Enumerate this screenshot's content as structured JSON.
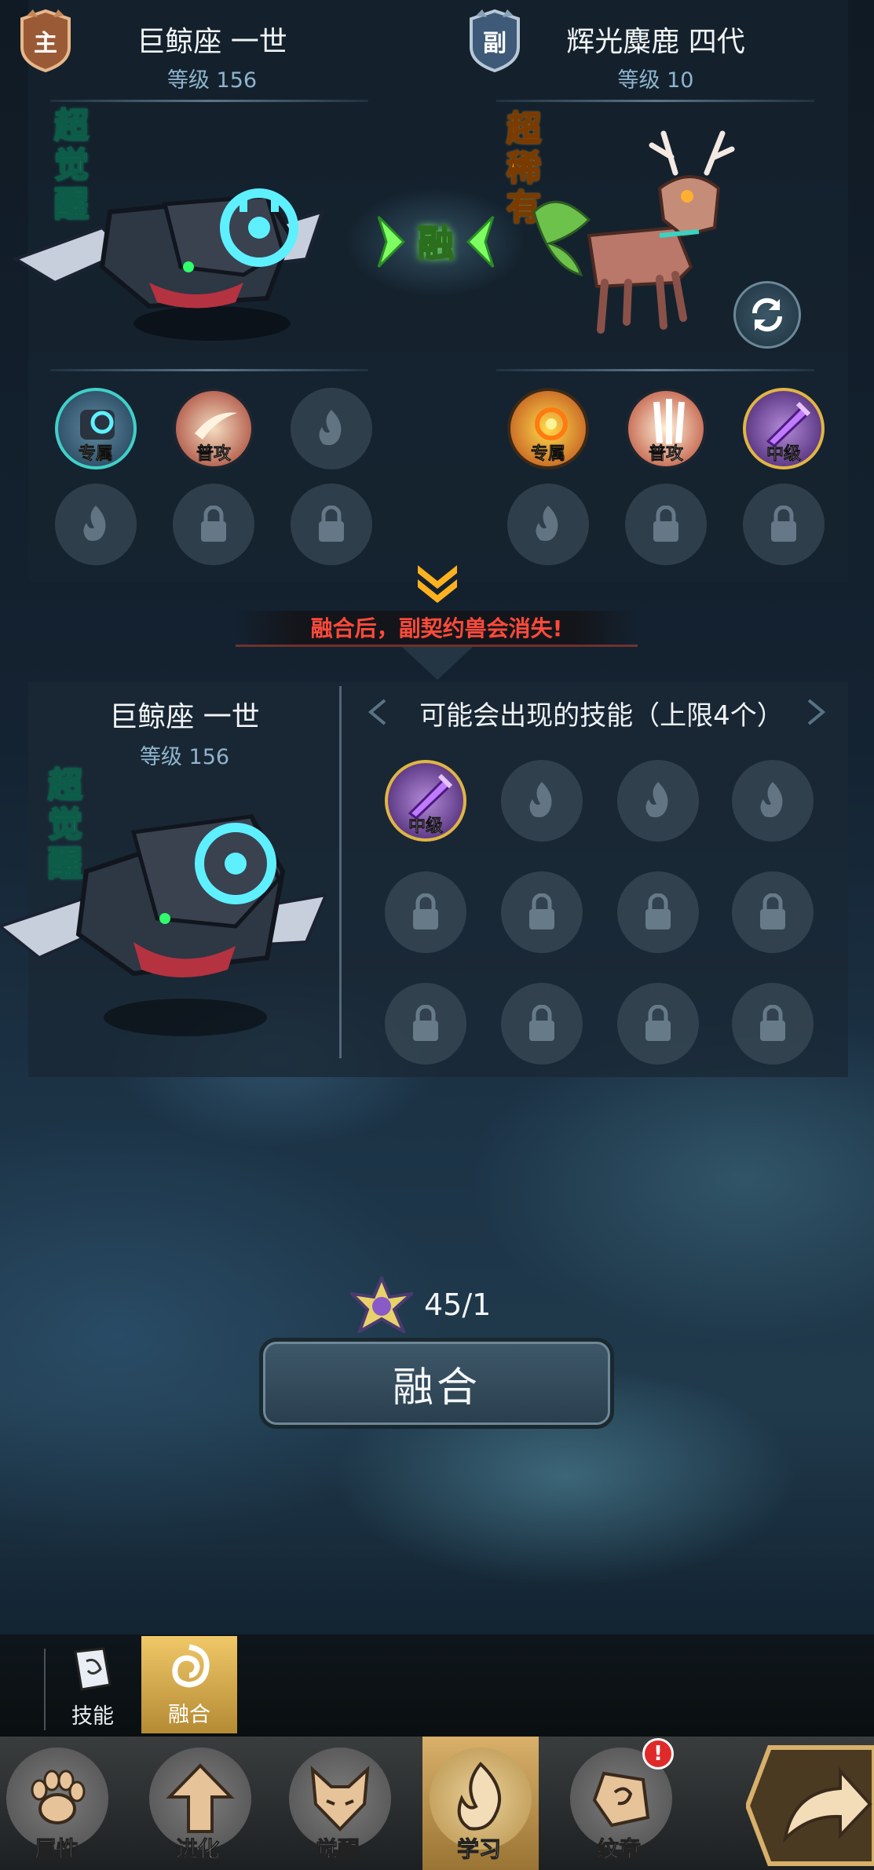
{
  "main_pet": {
    "badge": "主",
    "name": "巨鲸座 一世",
    "level": "等级 156",
    "rarity": "超觉醒",
    "skills": [
      {
        "label": "专属",
        "icon": "exclusive-skill-icon"
      },
      {
        "label": "普攻",
        "icon": "normal-attack-icon"
      }
    ]
  },
  "sub_pet": {
    "badge": "副",
    "name": "辉光麋鹿 四代",
    "level": "等级 10",
    "rarity": "超稀有",
    "skills": [
      {
        "label": "专属",
        "icon": "exclusive-skill-icon"
      },
      {
        "label": "普攻",
        "icon": "normal-attack-icon"
      },
      {
        "label": "中级",
        "icon": "intermediate-skill-icon"
      }
    ]
  },
  "fuse_center_label": "融",
  "warning_text": "融合后，副契约兽会消失!",
  "result": {
    "name": "巨鲸座 一世",
    "level": "等级 156",
    "rarity": "超觉醒",
    "skills_title": "可能会出现的技能（上限4个）",
    "skills": [
      {
        "label": "中级",
        "icon": "intermediate-skill-icon"
      }
    ]
  },
  "cost": {
    "icon": "star-shard-icon",
    "text": "45/1"
  },
  "fuse_button_label": "融合",
  "sub_tabs": [
    {
      "label": "技能",
      "icon": "book-icon",
      "active": false
    },
    {
      "label": "融合",
      "icon": "swirl-icon",
      "active": true
    }
  ],
  "nav": [
    {
      "label": "属性",
      "icon": "paw-icon"
    },
    {
      "label": "进化",
      "icon": "arrow-up-icon"
    },
    {
      "label": "觉醒",
      "icon": "fox-mask-icon"
    },
    {
      "label": "学习",
      "icon": "flame-icon",
      "active": true
    },
    {
      "label": "纹章",
      "icon": "emblem-icon",
      "alert": "!"
    }
  ],
  "colors": {
    "accent_gold": "#e0b544",
    "warning_red": "#ff4a3a",
    "rarity_green": "#bdf3d6",
    "rarity_orange": "#ffb31a"
  }
}
